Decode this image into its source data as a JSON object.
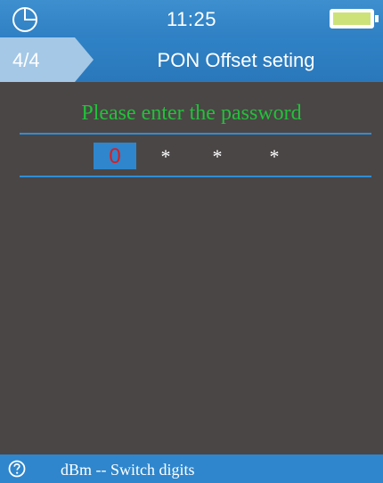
{
  "status_bar": {
    "time": "11:25",
    "clock_icon": "clock-icon",
    "battery_icon": "battery-icon",
    "battery_color": "#cde37a"
  },
  "title_bar": {
    "page_indicator": "4/4",
    "title": "PON Offset seting"
  },
  "password_entry": {
    "prompt": "Please enter the password",
    "prompt_color": "#22c13a",
    "digits": [
      "0",
      "*",
      "*",
      "*"
    ],
    "active_digit_index": 0,
    "active_digit_color": "#e01b1b"
  },
  "hint_bar": {
    "help_icon": "help-icon",
    "text": "dBm -- Switch digits"
  },
  "colors": {
    "accent": "#2f86cc",
    "background": "#4a4645"
  }
}
